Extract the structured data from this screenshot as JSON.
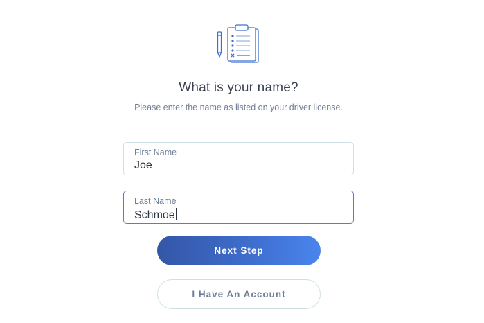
{
  "header": {
    "icon": "clipboard-checklist-icon",
    "title": "What is your name?",
    "subtitle": "Please enter the name as listed on your driver license."
  },
  "form": {
    "first_name": {
      "label": "First Name",
      "value": "Joe"
    },
    "last_name": {
      "label": "Last Name",
      "value": "Schmoe"
    }
  },
  "actions": {
    "next_label": "Next Step",
    "account_label": "I Have An Account"
  },
  "colors": {
    "accent_start": "#3456a6",
    "accent_end": "#4a85ec",
    "muted_text": "#6e7f97",
    "border": "#cfe0e4"
  }
}
